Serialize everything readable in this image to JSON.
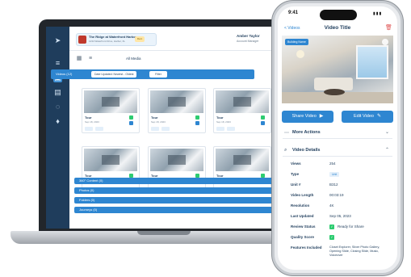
{
  "laptop": {
    "property": {
      "name": "The Ridge at Waterfront Harbor",
      "address": "1234 Waterfront Drive, Harbor, FL",
      "badge": "Rent"
    },
    "user": {
      "name": "Amber Taylor",
      "subtitle": "Account Manager"
    },
    "toolbar": {
      "label": "All Media",
      "add": "+"
    },
    "filter_section": {
      "label": "Videos (12)",
      "filter_value": "Date Updated: Newest - Oldest",
      "filter_button": "Filter"
    },
    "cards": [
      {
        "title": "Tour",
        "date": "Sep 18, 2023"
      },
      {
        "title": "Tour",
        "date": "Sep 18, 2023"
      },
      {
        "title": "Tour",
        "date": "Sep 18, 2023"
      },
      {
        "title": "Tour",
        "date": "Sep 18, 2023"
      },
      {
        "title": "Tour",
        "date": "Sep 18, 2023"
      },
      {
        "title": "Tour",
        "date": "Sep 18, 2023"
      }
    ],
    "sections": [
      {
        "label": "360° Content (0)"
      },
      {
        "label": "Photos (0)"
      },
      {
        "label": "Folders (0)"
      },
      {
        "label": "Journeys (0)"
      }
    ]
  },
  "phone": {
    "time": "9:41",
    "status_icons": "▮▮▮",
    "back": "< Videos",
    "title": "Video Title",
    "video_badge": "Building Name",
    "share_button": "Share Video",
    "edit_button": "Edit Video",
    "more_actions": "More Actions",
    "video_details": "Video Details",
    "details": [
      {
        "label": "Views",
        "value": "254"
      },
      {
        "label": "Type",
        "value": "Unit"
      },
      {
        "label": "Unit #",
        "value": "B312"
      },
      {
        "label": "Video Length",
        "value": "00:03:19"
      },
      {
        "label": "Resolution",
        "value": "4K"
      },
      {
        "label": "Last Updated",
        "value": "Sep 05, 2023"
      },
      {
        "label": "Review Status",
        "value": "Ready for Share"
      },
      {
        "label": "Quality Score",
        "value": "✓"
      }
    ],
    "features_label": "Features Included",
    "features_value": "Closet Explorer, Sliver Photo Gallery, Opening Slide, Closing Slide, Music, Voiceover"
  },
  "colors": {
    "accent": "#2e86d1",
    "sidebar": "#1f3d5c",
    "success": "#2ecc71",
    "danger": "#e05656"
  }
}
